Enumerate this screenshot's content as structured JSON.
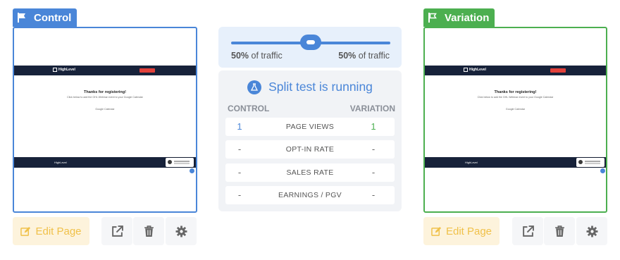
{
  "colors": {
    "control": "#4a86d8",
    "variation": "#4caf50",
    "edit": "#f0c14a"
  },
  "control": {
    "tag_label": "Control",
    "preview": {
      "brand": "HighLevel",
      "heading": "Thanks for registering!",
      "subtext": "Click below to add the GHL Webinar event to your Google Calendar",
      "link": "Google Calendar",
      "footer_brand": "HighLevel"
    },
    "edit_label": "Edit Page"
  },
  "variation": {
    "tag_label": "Variation",
    "preview": {
      "brand": "HighLevel",
      "heading": "Thanks for registering!",
      "subtext": "Click below to add the GHL Webinar event to your Google Calendar",
      "link": "Google Calendar",
      "footer_brand": "HighLevel"
    },
    "edit_label": "Edit Page"
  },
  "traffic": {
    "left_pct": "50%",
    "left_suffix": " of traffic",
    "right_pct": "50%",
    "right_suffix": " of traffic",
    "split": 0.5
  },
  "status": "Split test is running",
  "columns": {
    "left": "CONTROL",
    "right": "VARIATION"
  },
  "metrics": [
    {
      "label": "PAGE VIEWS",
      "control": "1",
      "variation": "1"
    },
    {
      "label": "OPT-IN RATE",
      "control": "-",
      "variation": "-"
    },
    {
      "label": "SALES RATE",
      "control": "-",
      "variation": "-"
    },
    {
      "label": "EARNINGS / PGV",
      "control": "-",
      "variation": "-"
    }
  ]
}
